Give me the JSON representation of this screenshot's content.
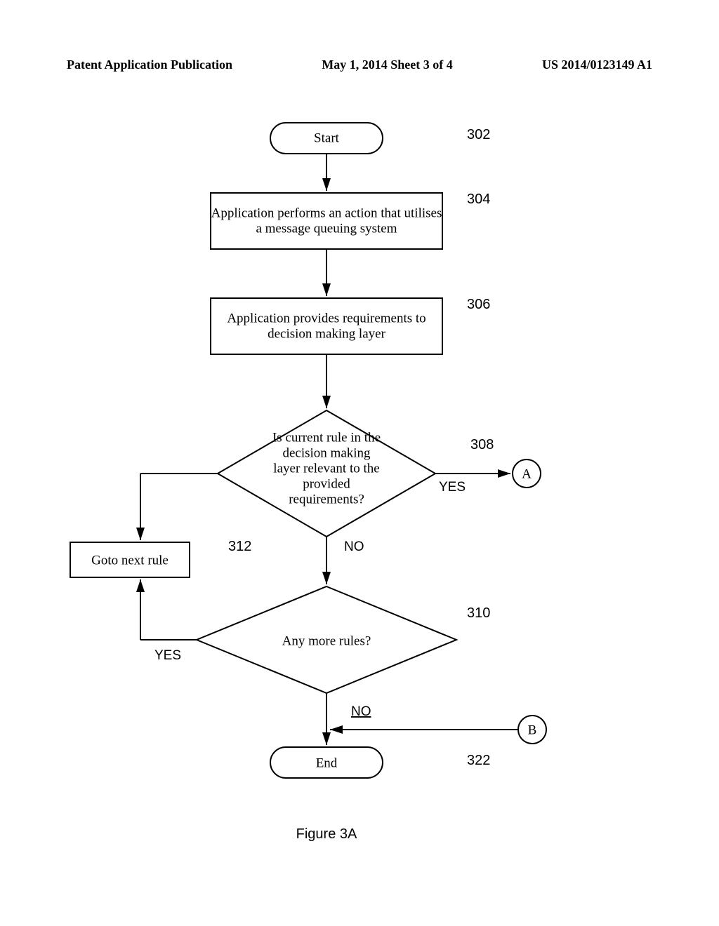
{
  "header": {
    "left": "Patent Application Publication",
    "mid": "May 1, 2014  Sheet 3 of 4",
    "right": "US 2014/0123149 A1"
  },
  "nodes": {
    "start": "Start",
    "end": "End",
    "step304_l1": "Application performs an action that utilises",
    "step304_l2": "a message queuing system",
    "step306_l1": "Application provides requirements to",
    "step306_l2": "decision making layer",
    "dec308_l1": "Is current rule in the",
    "dec308_l2": "decision making",
    "dec308_l3": "layer relevant to the",
    "dec308_l4": "provided",
    "dec308_l5": "requirements?",
    "dec310": "Any  more rules?",
    "goto": "Goto next rule",
    "connA": "A",
    "connB": "B"
  },
  "branches": {
    "yes308": "YES",
    "no308": "NO",
    "yes310": "YES",
    "no310": "NO"
  },
  "refs": {
    "r302": "302",
    "r304": "304",
    "r306": "306",
    "r308": "308",
    "r310": "310",
    "r312": "312",
    "r322": "322"
  },
  "caption": "Figure 3A"
}
